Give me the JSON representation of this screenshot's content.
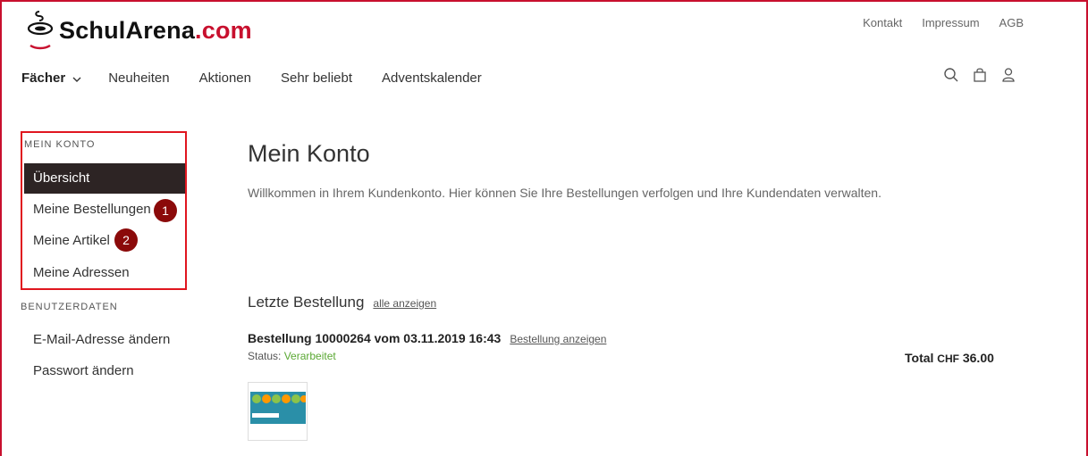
{
  "brand": {
    "name_part1": "SchulArena",
    "name_part2": ".com",
    "accent_color": "#c8102e",
    "logo_icon": "flask-logo-icon"
  },
  "top_links": [
    "Kontakt",
    "Impressum",
    "AGB"
  ],
  "nav": {
    "items": [
      "Fächer",
      "Neuheiten",
      "Aktionen",
      "Sehr beliebt",
      "Adventskalender"
    ],
    "icons": [
      "search-icon",
      "bag-icon",
      "user-icon"
    ]
  },
  "sidebar": {
    "heading_account": "MEIN KONTO",
    "account_items": [
      "Übersicht",
      "Meine Bestellungen",
      "Meine Artikel",
      "Meine Adressen"
    ],
    "active_item": "Übersicht",
    "heading_user": "BENUTZERDATEN",
    "user_items": [
      "E-Mail-Adresse ändern",
      "Passwort ändern"
    ],
    "badges": [
      "1",
      "2"
    ]
  },
  "main": {
    "title": "Mein Konto",
    "welcome": "Willkommen in Ihrem Kundenkonto. Hier können Sie Ihre Bestellungen verfolgen und Ihre Kundendaten verwalten.",
    "last_order_title": "Letzte Bestellung",
    "show_all_link": "alle anzeigen",
    "order_text": "Bestellung 10000264 vom 03.11.2019 16:43",
    "order_link": "Bestellung anzeigen",
    "status_label": "Status:",
    "status_value": "Verarbeitet",
    "total_label": "Total",
    "total_currency": "CHF",
    "total_value": "36.00"
  }
}
